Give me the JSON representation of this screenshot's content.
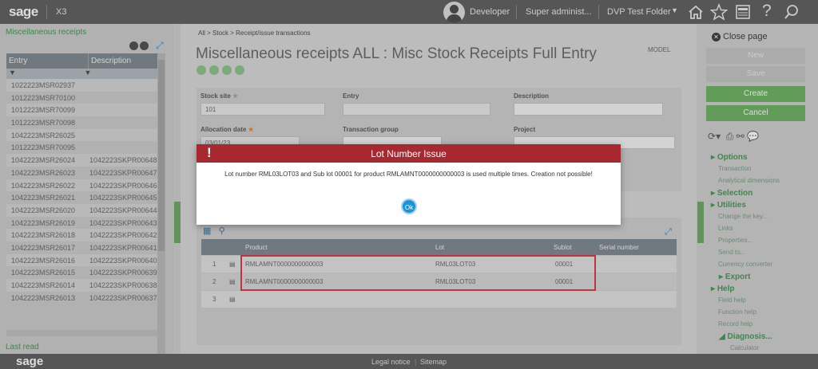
{
  "topbar": {
    "logo": "sage",
    "product": "X3",
    "user": "Developer",
    "role": "Super administ...",
    "folder": "DVP Test Folder",
    "icons": [
      "home-icon",
      "star-icon",
      "news-icon",
      "help-icon",
      "search-icon"
    ]
  },
  "left_panel": {
    "title": "Miscellaneous receipts",
    "columns": [
      "Entry",
      "Description"
    ],
    "rows": [
      [
        "1022223MSR02937",
        ""
      ],
      [
        "1012223MSR70100",
        ""
      ],
      [
        "1012223MSR70099",
        ""
      ],
      [
        "1012223MSR70098",
        ""
      ],
      [
        "1042223MSR26025",
        ""
      ],
      [
        "1012223MSR70095",
        ""
      ],
      [
        "1042223MSR26024",
        "1042223SKPR00648"
      ],
      [
        "1042223MSR26023",
        "1042223SKPR00647"
      ],
      [
        "1042223MSR26022",
        "1042223SKPR00646"
      ],
      [
        "1042223MSR26021",
        "1042223SKPR00645"
      ],
      [
        "1042223MSR26020",
        "1042223SKPR00644"
      ],
      [
        "1042223MSR26019",
        "1042223SKPR00643"
      ],
      [
        "1042223MSR26018",
        "1042223SKPR00642"
      ],
      [
        "1042223MSR26017",
        "1042223SKPR00641"
      ],
      [
        "1042223MSR26016",
        "1042223SKPR00640"
      ],
      [
        "1042223MSR26015",
        "1042223SKPR00639"
      ],
      [
        "1042223MSR26014",
        "1042223SKPR00638"
      ],
      [
        "1042223MSR26013",
        "1042223SKPR00637"
      ]
    ],
    "last_read": "Last read"
  },
  "main": {
    "breadcrumb": "All >   Stock >   Receipt/issue transactions",
    "title": "Miscellaneous receipts ALL : Misc Stock Receipts Full Entry",
    "model": "MODEL",
    "fields": {
      "stock_site_label": "Stock site",
      "stock_site_value": "101",
      "entry_label": "Entry",
      "description_label": "Description",
      "allocation_date_label": "Allocation date",
      "allocation_date_value": "03/01/23",
      "transaction_group_label": "Transaction group",
      "project_label": "Project"
    },
    "grid": {
      "columns": [
        "Product",
        "Lot",
        "Sublot",
        "Serial number"
      ],
      "rows": [
        {
          "num": "1",
          "product": "RMLAMNT0000000000003",
          "lot": "RML03LOT03",
          "sublot": "00001"
        },
        {
          "num": "2",
          "product": "RMLAMNT0000000000003",
          "lot": "RML03LOT03",
          "sublot": "00001"
        },
        {
          "num": "3",
          "product": "",
          "lot": "",
          "sublot": ""
        }
      ]
    }
  },
  "right_panel": {
    "close_page": "Close page",
    "buttons": {
      "new": "New",
      "save": "Save",
      "create": "Create",
      "cancel": "Cancel"
    },
    "sections": {
      "options": "Options",
      "transaction": "Transaction",
      "analytical": "Analytical dimensions",
      "selection": "Selection",
      "utilities": "Utilities",
      "change_key": "Change the key...",
      "links": "Links",
      "properties": "Properties...",
      "send_to": "Send to...",
      "currency": "Currency converter",
      "export": "Export",
      "help": "Help",
      "field_help": "Field help",
      "function_help": "Function help",
      "record_help": "Record help",
      "diagnosis": "Diagnosis...",
      "calculator": "Calculator"
    }
  },
  "bottombar": {
    "logo": "sage",
    "legal": "Legal notice",
    "sitemap": "Sitemap"
  },
  "dialog": {
    "title": "Lot Number Issue",
    "message": "Lot number RML03LOT03 and Sub lot 00001 for product RMLAMNT0000000000003 is used multiple times. Creation not possible!",
    "ok": "Ok",
    "header_color": "#a82830"
  }
}
